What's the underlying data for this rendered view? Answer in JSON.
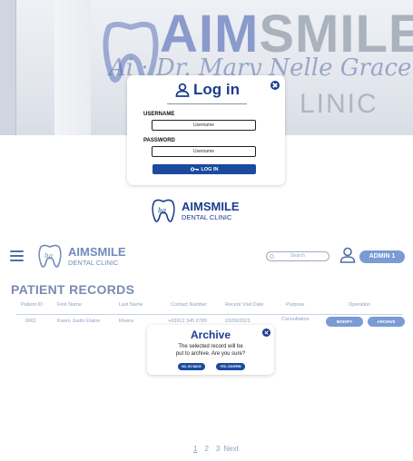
{
  "hero": {
    "sign_word_a": "AIM",
    "sign_word_b": "SMILE",
    "sign_script": "Ai  ·  Dr. Mary Nelle Grace",
    "sign_clinic": "LINIC"
  },
  "login": {
    "title": "Log in",
    "username_label": "USERNAME",
    "username_placeholder": "Username",
    "password_label": "PASSWORD",
    "password_placeholder": "Username",
    "button_label": "LOG IN"
  },
  "brand": {
    "name": "AIMSMILE",
    "sub": "DENTAL CLINIC"
  },
  "dashboard": {
    "search_placeholder": "Search",
    "admin_label": "ADMIN 1",
    "title": "PATIENT RECORDS",
    "columns": [
      "Patient ID",
      "First Name",
      "Last Name",
      "Contact Number",
      "Recent Visit Date",
      "Purpose",
      "Operation"
    ],
    "rows": [
      {
        "patient_id": "0001",
        "first_name": "Karen Justin Elaine",
        "last_name": "Rivera",
        "contact": "+63912 345 6789",
        "visit_date": "03/09/2023",
        "purpose": "Consultation",
        "modify_label": "MODIFY",
        "archive_label": "ARCHIVE"
      }
    ]
  },
  "archive_dialog": {
    "title": "Archive",
    "message_line1": "The selected record will be",
    "message_line2": "put to archive. Are you sure?",
    "no_label": "NO, GO BACK",
    "yes_label": "YES, CONFIRM"
  },
  "pagination": {
    "pages": [
      "1",
      "2",
      "3"
    ],
    "next_label": "Next"
  },
  "colors": {
    "primary": "#1b3d8f",
    "button": "#1b4a9e",
    "accent": "#7a9bd3",
    "muted_text": "#8fa0c2"
  }
}
